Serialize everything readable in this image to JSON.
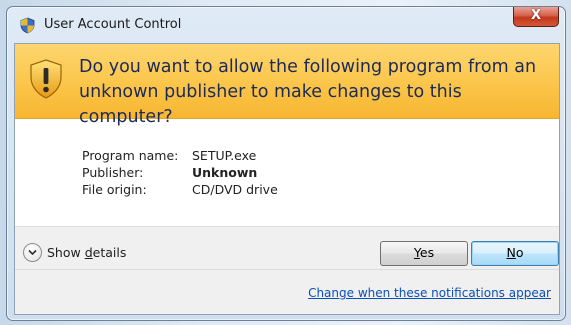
{
  "window": {
    "title": "User Account Control",
    "close_label": "X"
  },
  "banner": {
    "question": "Do you want to allow the following program from an unknown publisher to make changes to this computer?",
    "icon": "uac-shield-icon"
  },
  "details": {
    "program_name_label": "Program name:",
    "program_name_value": "SETUP.exe",
    "publisher_label": "Publisher:",
    "publisher_value": "Unknown",
    "file_origin_label": "File origin:",
    "file_origin_value": "CD/DVD drive"
  },
  "footer": {
    "show_details_pre": "Show ",
    "show_details_accel": "d",
    "show_details_post": "etails",
    "yes_accel": "Y",
    "yes_rest": "es",
    "no_accel": "N",
    "no_rest": "o",
    "change_link": "Change when these notifications appear"
  },
  "colors": {
    "banner": "#fbc54a",
    "link": "#0b4fb8",
    "question_text": "#1c2a57"
  }
}
